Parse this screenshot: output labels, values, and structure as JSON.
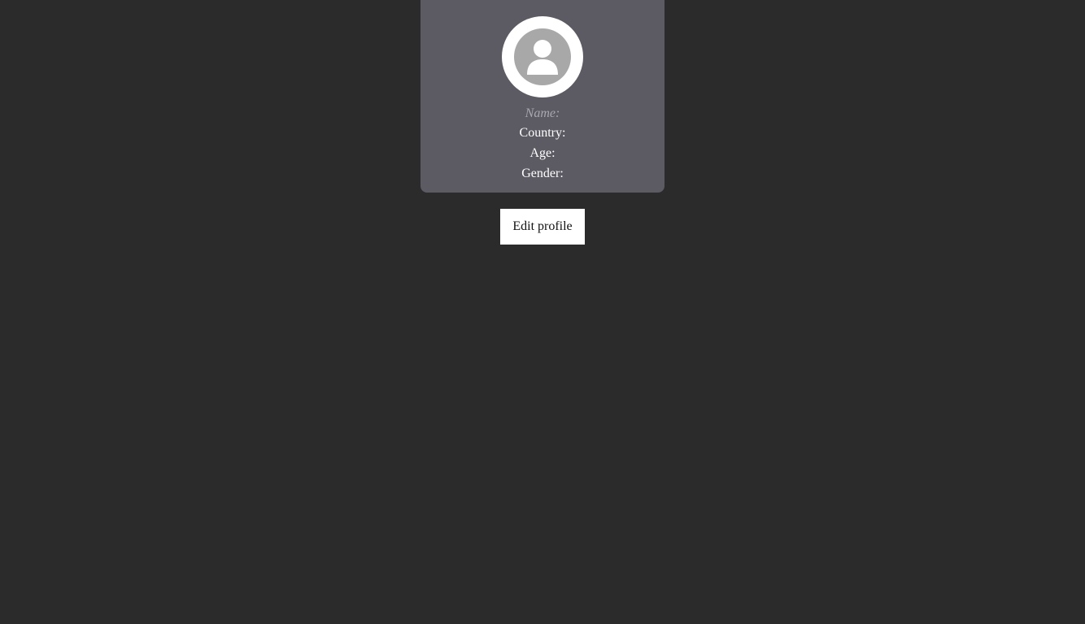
{
  "profile": {
    "avatar_icon": "user-icon",
    "name_label": "Name:",
    "country_label": "Country:",
    "age_label": "Age:",
    "gender_label": "Gender:"
  },
  "actions": {
    "edit_profile_label": "Edit profile"
  },
  "colors": {
    "page_background": "#2b2b2b",
    "card_background": "#5c5b64",
    "avatar_background": "#ffffff",
    "avatar_icon": "#a8a8a8",
    "muted_text": "#a9a8b0",
    "text": "#ffffff"
  }
}
